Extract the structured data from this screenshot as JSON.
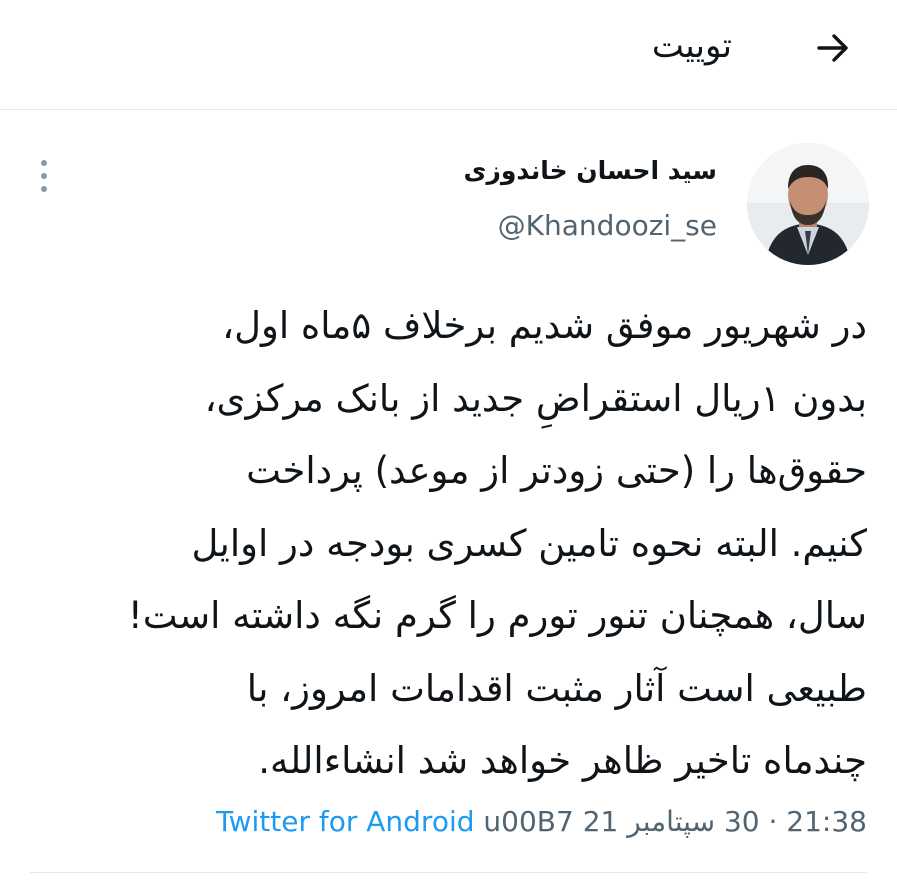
{
  "header": {
    "title": "توییت",
    "back_icon": "arrow-right-icon"
  },
  "author": {
    "display_name": "سید احسان خاندوزی",
    "handle": "@Khandoozi_se",
    "avatar_icon": "avatar-photo",
    "more_icon": "vertical-dots-icon"
  },
  "tweet": {
    "lines": [
      "در شهریور موفق شدیم برخلاف ۵ماه اول،",
      "بدون ۱ریال استقراضِ جدید از بانک مرکزی،",
      "حقوق‌ها را (حتی زودتر از موعد) پرداخت",
      "کنیم. البته نحوه تامین کسری بودجه در اوایل",
      "سال، همچنان تنور تورم را گرم نگه داشته است!",
      "طبیعی است آثار مثبت اقدامات امروز، با",
      "چندماه تاخیر ظاهر خواهد شد انشاءالله."
    ]
  },
  "meta": {
    "time": "21:38",
    "separator": " · ",
    "date": "30 سپتامبر 21",
    "middot": " u00B7 ",
    "source": "Twitter for Android"
  },
  "colors": {
    "text": "#0f1419",
    "secondary": "#536471",
    "link": "#1d9bf0",
    "divider": "#e6e9ec"
  }
}
